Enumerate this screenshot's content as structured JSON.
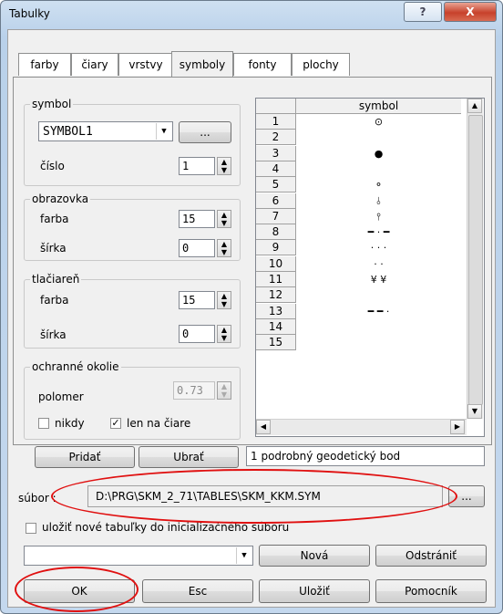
{
  "window": {
    "title": "Tabulky"
  },
  "titlebar": {
    "help_label": "?",
    "close_label": "X"
  },
  "tabs": [
    {
      "label": "farby"
    },
    {
      "label": "čiary"
    },
    {
      "label": "vrstvy"
    },
    {
      "label": "symboly",
      "active": true
    },
    {
      "label": "fonty"
    },
    {
      "label": "plochy"
    }
  ],
  "symbol_group": {
    "label": "symbol",
    "selected_symbol": "SYMBOL1",
    "browse_label": "...",
    "cislo_label": "číslo",
    "cislo_value": "1"
  },
  "obrazovka_group": {
    "label": "obrazovka",
    "farba_label": "farba",
    "farba_value": "15",
    "sirka_label": "šírka",
    "sirka_value": "0"
  },
  "tlaciaren_group": {
    "label": "tlačiareň",
    "farba_label": "farba",
    "farba_value": "15",
    "sirka_label": "šírka",
    "sirka_value": "0"
  },
  "okolie_group": {
    "label": "ochranné okolie",
    "polomer_label": "polomer",
    "polomer_value": "0.73",
    "nikdy_label": "nikdy",
    "nikdy_checked": false,
    "len_label": "len na čiare",
    "len_checked": true
  },
  "grid": {
    "header": "symbol",
    "rows": [
      "1",
      "2",
      "3",
      "4",
      "5",
      "6",
      "7",
      "8",
      "9",
      "10",
      "11",
      "12",
      "13",
      "14",
      "15"
    ],
    "symbols": [
      "⊙",
      "",
      "●",
      "",
      "⚬",
      "⫰",
      "⫯",
      "━ · ━",
      "· · ·",
      "· ·",
      "¥        ¥",
      "",
      "━ ━ ·",
      "",
      ""
    ]
  },
  "actions": {
    "pridat_label": "Pridať",
    "ubrat_label": "Ubrať",
    "description": "1 podrobný geodetický bod"
  },
  "file": {
    "label": "súbor :",
    "path": "D:\\PRG\\SKM_2_71\\TABLES\\SKM_KKM.SYM",
    "browse_label": "..."
  },
  "save_init": {
    "label": "uložiť nové tabuľky do inicializačného súboru",
    "checked": false
  },
  "bottom": {
    "combo_value": "",
    "nova_label": "Nová",
    "odstranit_label": "Odstrániť",
    "ok_label": "OK",
    "esc_label": "Esc",
    "ulozit_label": "Uložiť",
    "pomocnik_label": "Pomocník"
  },
  "colors": {
    "highlight_oval": "#e01010",
    "close_button": "#c7412b"
  }
}
